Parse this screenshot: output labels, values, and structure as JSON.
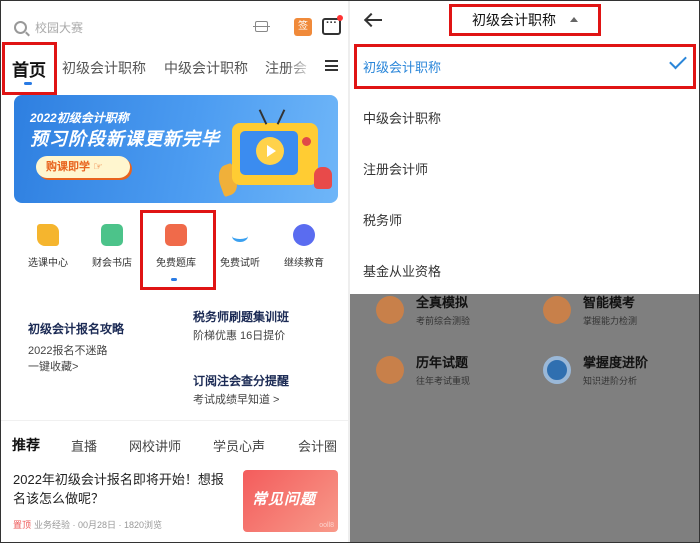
{
  "left": {
    "search": {
      "placeholder": "校园大赛"
    },
    "header_icons": {
      "calendar_char": "签"
    },
    "nav_tabs": [
      {
        "label": "首页",
        "active": true
      },
      {
        "label": "初级会计职称"
      },
      {
        "label": "中级会计职称"
      },
      {
        "label": "注册会"
      }
    ],
    "banner": {
      "line1": "2022初级会计职称",
      "line2": "预习阶段新课更新完毕",
      "button": "购课即学 ☞"
    },
    "quick_entries": [
      {
        "label": "选课中心",
        "color": "#f5b52e"
      },
      {
        "label": "财会书店",
        "color": "#4cc38a"
      },
      {
        "label": "免费题库",
        "color": "#f06a4a"
      },
      {
        "label": "免费试听",
        "color": "#3aa0f0"
      },
      {
        "label": "继续教育",
        "color": "#5a6cf0"
      }
    ],
    "info_blocks": [
      {
        "title": "初级会计报名攻略",
        "lines": [
          "2022报名不迷路",
          "一键收藏>"
        ]
      },
      {
        "title": "税务师刷题集训班",
        "lines": [
          "阶梯优惠 16日提价"
        ]
      },
      {
        "title": "订阅注会查分提醒",
        "lines": [
          "考试成绩早知道 >"
        ]
      }
    ],
    "content_tabs": [
      {
        "label": "推荐",
        "active": true
      },
      {
        "label": "直播"
      },
      {
        "label": "网校讲师"
      },
      {
        "label": "学员心声"
      },
      {
        "label": "会计圈"
      }
    ],
    "article": {
      "title": "2022年初级会计报名即将开始！想报名该怎么做呢？",
      "tag": "置顶",
      "meta": "业务经验 · 00月28日 · 1820浏览",
      "thumb_text": "常见问题",
      "thumb_mark": "ooll8"
    }
  },
  "right": {
    "title": "初级会计职称",
    "options": [
      {
        "label": "初级会计职称",
        "selected": true
      },
      {
        "label": "中级会计职称"
      },
      {
        "label": "注册会计师"
      },
      {
        "label": "税务师"
      },
      {
        "label": "基金从业资格"
      }
    ],
    "cards": [
      {
        "title": "全真模拟",
        "sub": "考前综合测验",
        "color": "#e8803a"
      },
      {
        "title": "智能模考",
        "sub": "掌握能力检测",
        "color": "#e8803a"
      },
      {
        "title": "历年试题",
        "sub": "往年考试重现",
        "color": "#e8803a"
      },
      {
        "title": "掌握度进阶",
        "sub": "知识进阶分析",
        "color": "#2a86d9"
      }
    ]
  },
  "colors": {
    "accent": "#2a86d9",
    "highlight_box": "#e01414",
    "banner": "#2e7fe0"
  }
}
